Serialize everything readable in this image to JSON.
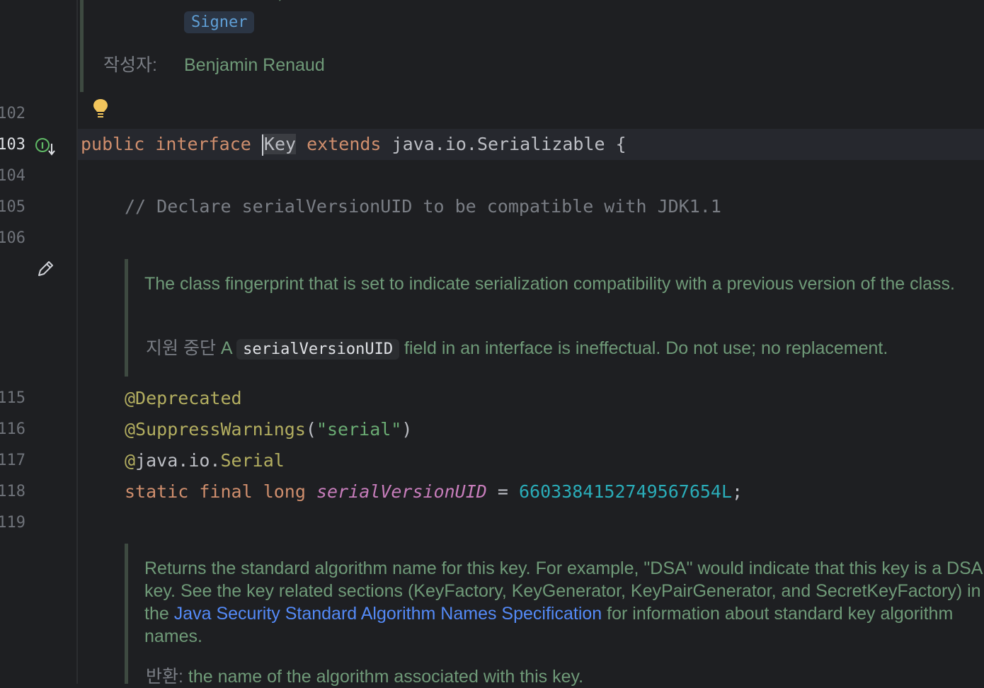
{
  "top_doc": {
    "see_chip": "Signer",
    "author_label": "작성자:",
    "author_value": "Benjamin Renaud"
  },
  "line_numbers": [
    "102",
    "103",
    "104",
    "105",
    "106",
    "115",
    "116",
    "117",
    "118",
    "119"
  ],
  "code": {
    "line103": {
      "kw_public": "public",
      "kw_interface": "interface",
      "class_name": "Key",
      "kw_extends": "extends",
      "super_type": "java.io.Serializable",
      "brace": "{"
    },
    "line105_comment": "// Declare serialVersionUID to be compatible with JDK1.1",
    "line115": "@Deprecated",
    "line116": {
      "annotation": "@SuppressWarnings",
      "open": "(",
      "arg": "\"serial\"",
      "close": ")"
    },
    "line117": {
      "at": "@",
      "pkg": "java.io.",
      "name": "Serial"
    },
    "line118": {
      "kw_static": "static",
      "kw_final": "final",
      "kw_long": "long",
      "field": "serialVersionUID",
      "eq": "=",
      "value": "6603384152749567654L",
      "semi": ";"
    }
  },
  "doc_serial": {
    "description": "The class fingerprint that is set to indicate serialization compatibility with a previous version of the class.",
    "deprecated_label": "지원 중단",
    "deprecated_prefix": "A",
    "deprecated_code": "serialVersionUID",
    "deprecated_text": "field in an interface is ineffectual. Do not use; no replacement."
  },
  "doc_algorithm": {
    "text_before_link": "Returns the standard algorithm name for this key. For example, \"DSA\" would indicate that this key is a DSA key. See the key related sections (KeyFactory, KeyGenerator, KeyPairGenerator, and SecretKeyFactory) in the",
    "link": "Java Security Standard Algorithm Names Specification",
    "text_after_link": "for information about standard key algorithm names.",
    "returns_label": "반환:",
    "returns_text": "the name of the algorithm associated with this key."
  },
  "colors": {
    "background": "#1e1f22",
    "keyword": "#cf8e6d",
    "annotation": "#b3ae60",
    "string": "#6aab73",
    "number": "#2aacb8",
    "field": "#c77dbb",
    "doc_text": "#6f9a78",
    "link": "#548af7"
  },
  "icons": [
    "bulb-icon",
    "implemented-interface-icon",
    "edit-pencil-icon"
  ]
}
